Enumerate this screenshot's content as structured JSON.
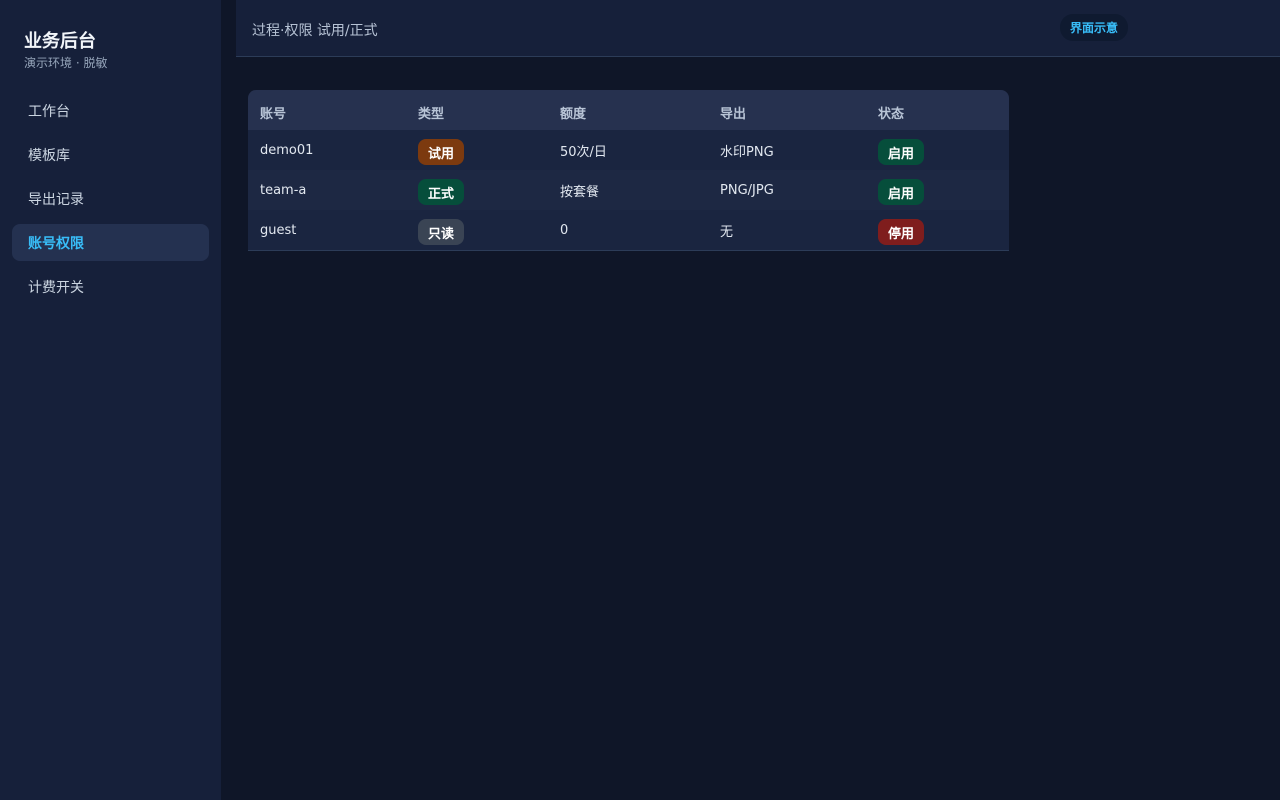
{
  "sidebar": {
    "brand_title": "业务后台",
    "brand_subtitle": "演示环境 · 脱敏",
    "items": [
      {
        "label": "工作台"
      },
      {
        "label": "模板库"
      },
      {
        "label": "导出记录"
      },
      {
        "label": "账号权限",
        "active": true
      },
      {
        "label": "计费开关"
      }
    ]
  },
  "header": {
    "title": "过程·权限 试用/正式",
    "badge": "界面示意"
  },
  "table": {
    "columns": [
      "账号",
      "类型",
      "额度",
      "导出",
      "状态"
    ],
    "rows": [
      {
        "account": "demo01",
        "type": "试用",
        "quota": "50次/日",
        "export": "水印PNG",
        "status": "启用"
      },
      {
        "account": "team-a",
        "type": "正式",
        "quota": "按套餐",
        "export": "PNG/JPG",
        "status": "启用"
      },
      {
        "account": "guest",
        "type": "只读",
        "quota": "0",
        "export": "无",
        "status": "停用"
      }
    ]
  },
  "colors": {
    "accent": "#38bdf8",
    "trial": "#7c3a0f",
    "formal": "#064e3b",
    "readonly": "#3a4454",
    "enabled": "#064e3b",
    "disabled": "#7f1d1d"
  }
}
